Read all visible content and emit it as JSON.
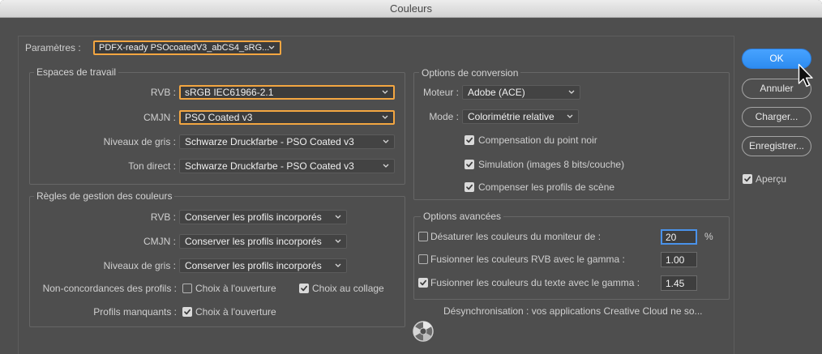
{
  "window": {
    "title": "Couleurs"
  },
  "settings": {
    "label": "Paramètres :",
    "value": "PDFX-ready PSOcoatedV3_abCS4_sRG...",
    "highlighted": true
  },
  "working_spaces": {
    "title": "Espaces de travail",
    "rows": [
      {
        "label": "RVB :",
        "value": "sRGB IEC61966-2.1",
        "highlighted": true
      },
      {
        "label": "CMJN :",
        "value": "PSO Coated v3",
        "highlighted": true
      },
      {
        "label": "Niveaux de gris :",
        "value": "Schwarze Druckfarbe - PSO Coated v3",
        "highlighted": false
      },
      {
        "label": "Ton direct :",
        "value": "Schwarze Druckfarbe - PSO Coated v3",
        "highlighted": false
      }
    ]
  },
  "policies": {
    "title": "Règles de gestion des couleurs",
    "rows": [
      {
        "label": "RVB :",
        "value": "Conserver les profils incorporés"
      },
      {
        "label": "CMJN :",
        "value": "Conserver les profils incorporés"
      },
      {
        "label": "Niveaux de gris :",
        "value": "Conserver les profils incorporés"
      }
    ],
    "mismatch": {
      "label": "Non-concordances des profils :",
      "ask_when_opening": {
        "label": "Choix à l'ouverture",
        "checked": false
      },
      "ask_when_pasting": {
        "label": "Choix au collage",
        "checked": true
      }
    },
    "missing": {
      "label": "Profils manquants :",
      "ask_when_opening": {
        "label": "Choix à l'ouverture",
        "checked": true
      }
    }
  },
  "conversion": {
    "title": "Options de conversion",
    "engine": {
      "label": "Moteur :",
      "value": "Adobe (ACE)"
    },
    "intent": {
      "label": "Mode :",
      "value": "Colorimétrie relative"
    },
    "options": [
      {
        "label": "Compensation du point noir",
        "checked": true
      },
      {
        "label": "Simulation (images 8 bits/couche)",
        "checked": true
      },
      {
        "label": "Compenser les profils de scène",
        "checked": true
      }
    ]
  },
  "advanced": {
    "title": "Options avancées",
    "desaturate": {
      "label": "Désaturer les couleurs du moniteur de :",
      "checked": false,
      "value": "20",
      "unit": "%",
      "focused": true
    },
    "blend_rgb": {
      "label": "Fusionner les couleurs RVB avec le gamma :",
      "checked": false,
      "value": "1.00"
    },
    "blend_text": {
      "label": "Fusionner les couleurs du texte avec le gamma :",
      "checked": true,
      "value": "1.45"
    }
  },
  "sync": {
    "message": "Désynchronisation : vos applications Creative Cloud ne so..."
  },
  "buttons": {
    "ok": "OK",
    "cancel": "Annuler",
    "load": "Charger...",
    "save": "Enregistrer..."
  },
  "preview": {
    "label": "Aperçu",
    "checked": true
  },
  "icons": {
    "dropdown": "chevron-down-icon",
    "checkbox": "checkmark-icon",
    "sync": "color-sync-icon",
    "cursor": "pointer-cursor-icon"
  },
  "colors": {
    "panel": "#4e4e4e",
    "highlight": "#f3a641",
    "ok_button": "#2d8cf0",
    "focus": "#4a92ea"
  }
}
